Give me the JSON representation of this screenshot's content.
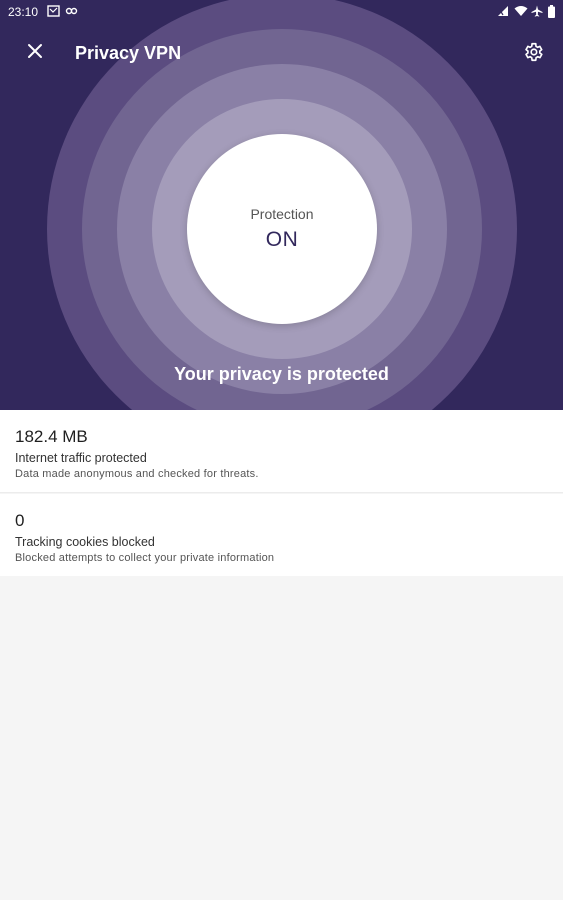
{
  "status_bar": {
    "time": "23:10"
  },
  "app_bar": {
    "title": "Privacy VPN"
  },
  "protection": {
    "label": "Protection",
    "state": "ON",
    "message": "Your privacy is protected"
  },
  "stats": [
    {
      "value": "182.4 MB",
      "title": "Internet traffic protected",
      "description": "Data made anonymous and checked for threats."
    },
    {
      "value": "0",
      "title": "Tracking cookies blocked",
      "description": "Blocked attempts to collect your private information"
    }
  ],
  "colors": {
    "header_background": "#32285c",
    "accent": "#32285c",
    "page_background": "#f5f5f5"
  },
  "icons": {
    "close": "close-icon",
    "settings": "gear-icon"
  }
}
